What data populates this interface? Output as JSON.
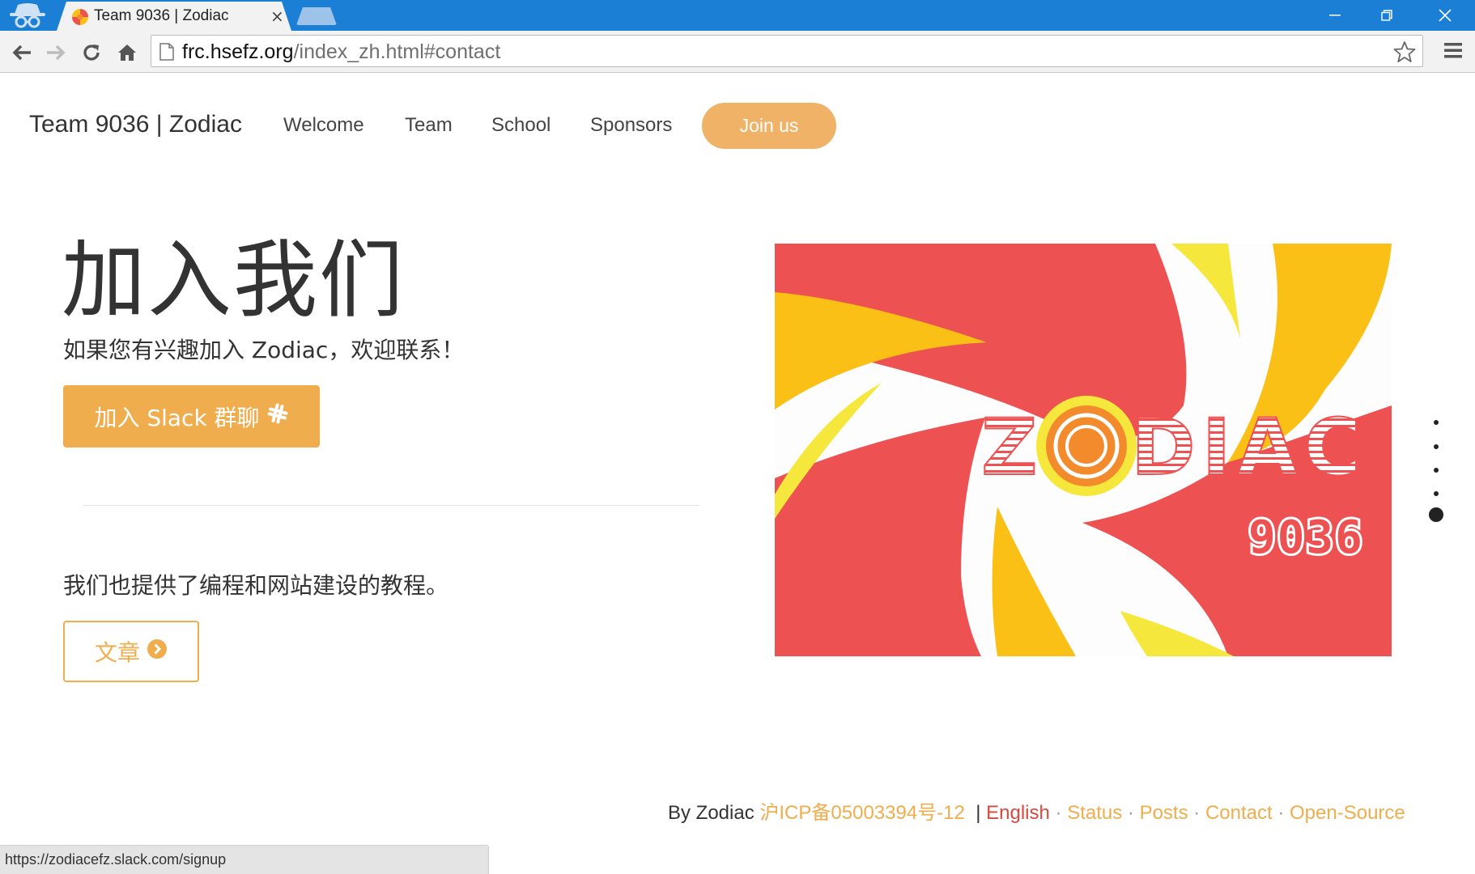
{
  "browser": {
    "tab_title": "Team 9036 | Zodiac",
    "tab_close": "×",
    "url_host": "frc.hsefz.org",
    "url_path": "/index_zh.html#contact",
    "status_url": "https://zodiacefz.slack.com/signup"
  },
  "nav": {
    "brand": "Team 9036 | Zodiac",
    "links": [
      "Welcome",
      "Team",
      "School",
      "Sponsors"
    ],
    "cta": "Join us"
  },
  "hero": {
    "title": "加入我们",
    "subtitle": "如果您有兴趣加入 Zodiac，欢迎联系！",
    "slack_button": "加入 Slack 群聊",
    "tutorial_text": "我们也提供了编程和网站建设的教程。",
    "article_button": "文章"
  },
  "logo": {
    "word": "ZODIAC",
    "number": "9036"
  },
  "footer": {
    "by": "By Zodiac",
    "icp": "沪ICP备05003394号-12",
    "bar": "|",
    "links": [
      "English",
      "Status",
      "Posts",
      "Contact",
      "Open-Source"
    ],
    "dot": "·"
  },
  "pager": {
    "count": 5,
    "active_index": 4
  },
  "colors": {
    "accent": "#f0ad4e",
    "logo_red": "#ee5151",
    "logo_orange": "#fbc015",
    "logo_yellow": "#f6e73c",
    "chrome_blue": "#1c7fd6"
  }
}
